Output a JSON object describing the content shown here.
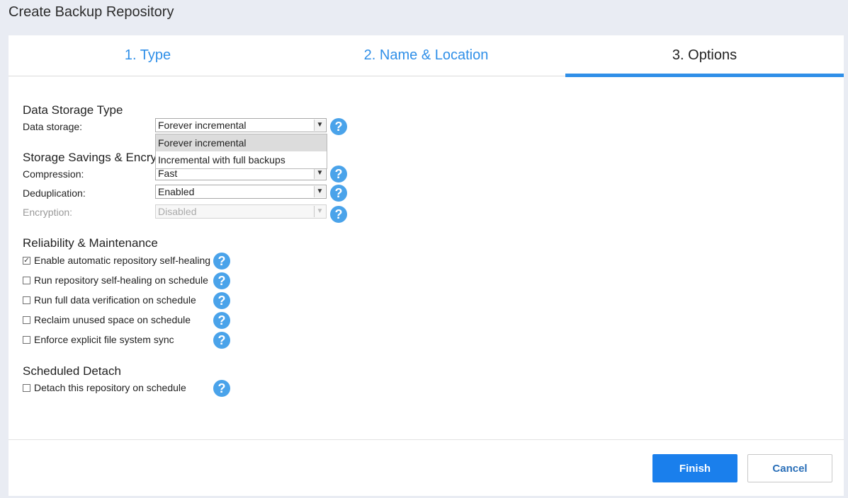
{
  "window": {
    "title": "Create Backup Repository"
  },
  "tabs": [
    {
      "label": "1. Type"
    },
    {
      "label": "2. Name & Location"
    },
    {
      "label": "3. Options"
    }
  ],
  "data_storage_section": {
    "title": "Data Storage Type",
    "data_storage_label": "Data storage:",
    "data_storage_value": "Forever incremental",
    "options": [
      "Forever incremental",
      "Incremental with full backups"
    ]
  },
  "savings_section": {
    "title": "Storage Savings & Encry",
    "compression_label": "Compression:",
    "compression_value": "Fast",
    "deduplication_label": "Deduplication:",
    "deduplication_value": "Enabled",
    "encryption_label": "Encryption:",
    "encryption_value": "Disabled"
  },
  "reliability_section": {
    "title": "Reliability & Maintenance",
    "items": [
      {
        "label": "Enable automatic repository self-healing",
        "checked": true
      },
      {
        "label": "Run repository self-healing on schedule",
        "checked": false
      },
      {
        "label": "Run full data verification on schedule",
        "checked": false
      },
      {
        "label": "Reclaim unused space on schedule",
        "checked": false
      },
      {
        "label": "Enforce explicit file system sync",
        "checked": false
      }
    ]
  },
  "detach_section": {
    "title": "Scheduled Detach",
    "item": {
      "label": "Detach this repository on schedule",
      "checked": false
    }
  },
  "icons": {
    "help": "?",
    "dropdown_arrow": "▼",
    "check": "✓"
  },
  "buttons": {
    "finish": "Finish",
    "cancel": "Cancel"
  }
}
